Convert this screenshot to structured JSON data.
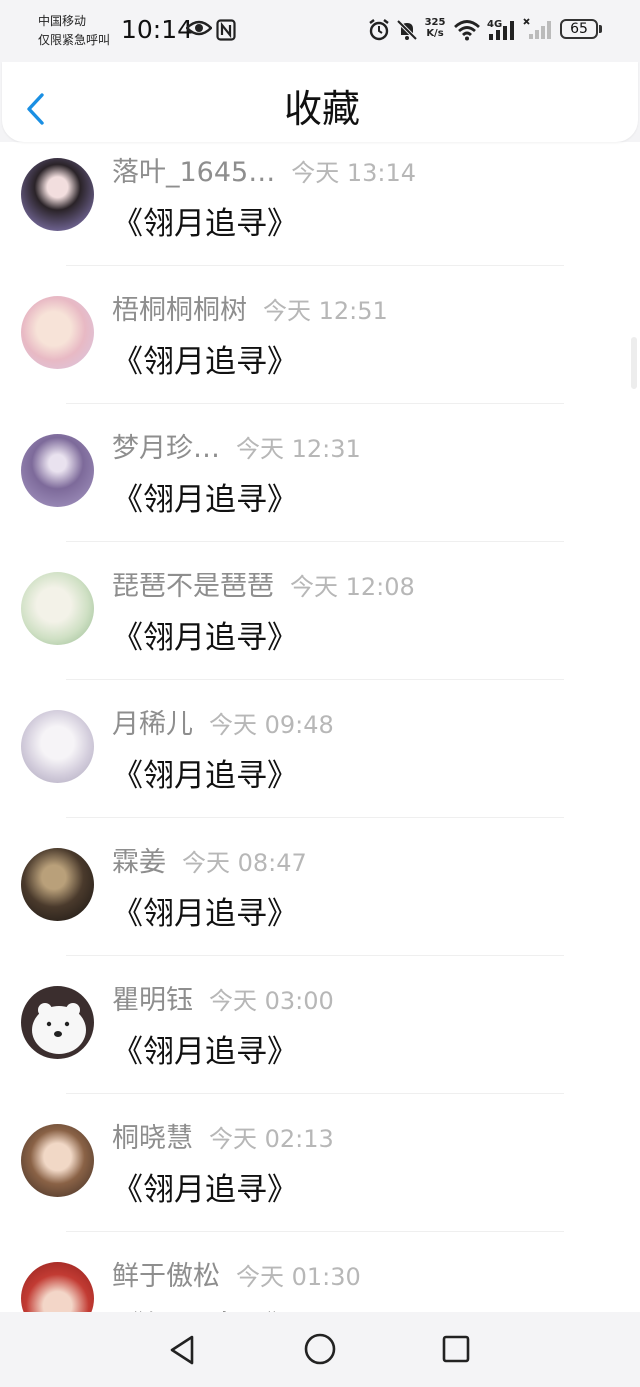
{
  "status_bar": {
    "carrier_line1": "中国移动",
    "carrier_line2": "仅限紧急呼叫",
    "time": "10:14",
    "net_speed_value": "325",
    "net_speed_unit": "K/s",
    "battery": "65"
  },
  "header": {
    "title": "收藏",
    "back_icon": "chevron-left-icon",
    "accent_color": "#1a8fe3"
  },
  "favorites": [
    {
      "name": "落叶_1645…",
      "time": "今天 13:14",
      "title": "《翎月追寻》"
    },
    {
      "name": "梧桐桐桐树",
      "time": "今天 12:51",
      "title": "《翎月追寻》"
    },
    {
      "name": "梦月珍…",
      "time": "今天 12:31",
      "title": "《翎月追寻》"
    },
    {
      "name": "琵琶不是琶琶",
      "time": "今天 12:08",
      "title": "《翎月追寻》"
    },
    {
      "name": "月稀儿",
      "time": "今天 09:48",
      "title": "《翎月追寻》"
    },
    {
      "name": "霖姜",
      "time": "今天 08:47",
      "title": "《翎月追寻》"
    },
    {
      "name": "瞿明钰",
      "time": "今天 03:00",
      "title": "《翎月追寻》"
    },
    {
      "name": "桐晓慧",
      "time": "今天 02:13",
      "title": "《翎月追寻》"
    },
    {
      "name": "鲜于傲松",
      "time": "今天 01:30",
      "title": "《翎月追寻》"
    }
  ],
  "nav_bar": {
    "back": "triangle-back-icon",
    "home": "circle-home-icon",
    "recent": "square-recent-icon"
  }
}
